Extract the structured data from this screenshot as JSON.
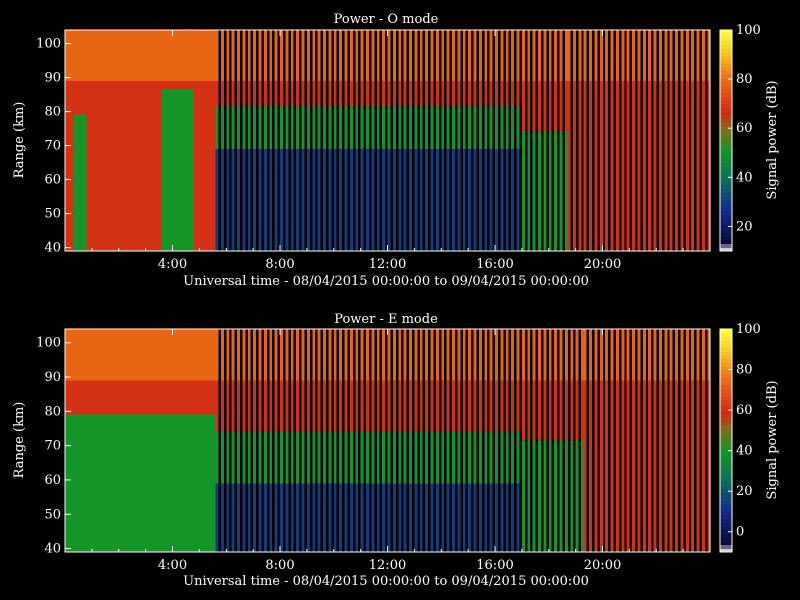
{
  "chart_data": [
    {
      "type": "heatmap",
      "title": "Power - O mode",
      "xlabel": "Universal time - 08/04/2015 00:00:00 to 09/04/2015 00:00:00",
      "ylabel": "Range (km)",
      "colorbar_label": "Signal power (dB)",
      "xlim_hours": [
        0,
        24
      ],
      "x_ticks": [
        "4:00",
        "8:00",
        "12:00",
        "16:00",
        "20:00"
      ],
      "x_tick_hours": [
        4,
        8,
        12,
        16,
        20
      ],
      "ylim_km": [
        39,
        104
      ],
      "y_ticks": [
        40,
        50,
        60,
        70,
        80,
        90,
        100
      ],
      "colorbar_range": [
        10,
        100
      ],
      "colorbar_ticks": [
        20,
        40,
        60,
        80,
        100
      ],
      "profile": [
        {
          "from_h": 0.0,
          "to_h": 0.3,
          "dense_top_km": 104,
          "mid_km": 0,
          "low_km": 0
        },
        {
          "from_h": 0.3,
          "to_h": 0.8,
          "dense_top_km": 104,
          "mid_km": 80,
          "low_km": 0
        },
        {
          "from_h": 0.8,
          "to_h": 3.6,
          "dense_top_km": 104,
          "mid_km": 0,
          "low_km": 0
        },
        {
          "from_h": 3.6,
          "to_h": 4.8,
          "dense_top_km": 104,
          "mid_km": 86,
          "low_km": 0
        },
        {
          "from_h": 4.8,
          "to_h": 5.6,
          "dense_top_km": 104,
          "mid_km": 0,
          "low_km": 0
        },
        {
          "from_h": 5.6,
          "to_h": 17.0,
          "dense_top_km": 104,
          "mid_km": 82,
          "low_km": 68
        },
        {
          "from_h": 17.0,
          "to_h": 18.7,
          "dense_top_km": 104,
          "mid_km": 75,
          "low_km": 0
        },
        {
          "from_h": 18.7,
          "to_h": 24.0,
          "dense_top_km": 104,
          "mid_km": 0,
          "low_km": 0
        }
      ],
      "sampling": {
        "gap_start_h": 5.6,
        "column_period_h": 0.2,
        "column_duty": 0.55
      }
    },
    {
      "type": "heatmap",
      "title": "Power - E mode",
      "xlabel": "Universal time - 08/04/2015 00:00:00 to 09/04/2015 00:00:00",
      "ylabel": "Range (km)",
      "colorbar_label": "Signal power (dB)",
      "xlim_hours": [
        0,
        24
      ],
      "x_ticks": [
        "4:00",
        "8:00",
        "12:00",
        "16:00",
        "20:00"
      ],
      "x_tick_hours": [
        4,
        8,
        12,
        16,
        20
      ],
      "ylim_km": [
        39,
        104
      ],
      "y_ticks": [
        40,
        50,
        60,
        70,
        80,
        90,
        100
      ],
      "colorbar_range": [
        -10,
        100
      ],
      "colorbar_ticks": [
        0,
        20,
        40,
        60,
        80,
        100
      ],
      "profile": [
        {
          "from_h": 0.0,
          "to_h": 0.3,
          "dense_top_km": 104,
          "mid_km": 80,
          "low_km": 0
        },
        {
          "from_h": 0.3,
          "to_h": 3.3,
          "dense_top_km": 104,
          "mid_km": 80,
          "low_km": 0
        },
        {
          "from_h": 3.3,
          "to_h": 4.5,
          "dense_top_km": 104,
          "mid_km": 80,
          "low_km": 0
        },
        {
          "from_h": 4.5,
          "to_h": 5.6,
          "dense_top_km": 104,
          "mid_km": 80,
          "low_km": 0
        },
        {
          "from_h": 5.6,
          "to_h": 17.0,
          "dense_top_km": 104,
          "mid_km": 75,
          "low_km": 58
        },
        {
          "from_h": 17.0,
          "to_h": 19.3,
          "dense_top_km": 104,
          "mid_km": 72,
          "low_km": 0
        },
        {
          "from_h": 19.3,
          "to_h": 24.0,
          "dense_top_km": 104,
          "mid_km": 0,
          "low_km": 0
        }
      ],
      "sampling": {
        "gap_start_h": 5.6,
        "column_period_h": 0.2,
        "column_duty": 0.55
      }
    }
  ]
}
